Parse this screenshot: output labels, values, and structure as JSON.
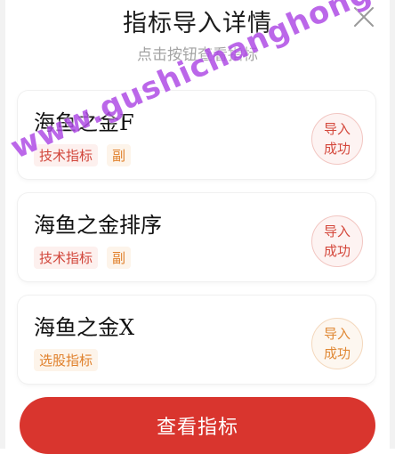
{
  "dialog": {
    "title": "指标导入详情",
    "subtitle": "点击按钮查看指标"
  },
  "cards": [
    {
      "name": "海鱼之金F",
      "tags": [
        "技术指标",
        "副"
      ],
      "status_line1": "导入",
      "status_line2": "成功"
    },
    {
      "name": "海鱼之金排序",
      "tags": [
        "技术指标",
        "副"
      ],
      "status_line1": "导入",
      "status_line2": "成功"
    },
    {
      "name": "海鱼之金X",
      "tags": [
        "选股指标"
      ],
      "status_line1": "导入",
      "status_line2": "成功"
    }
  ],
  "actions": {
    "view_indicators": "查看指标"
  },
  "watermark": {
    "text": "www.gushichanghong.com"
  },
  "colors": {
    "primary": "#d9352e",
    "tag_red": "#d1453a",
    "tag_orange": "#e0802b",
    "watermark": "#b04de6"
  }
}
